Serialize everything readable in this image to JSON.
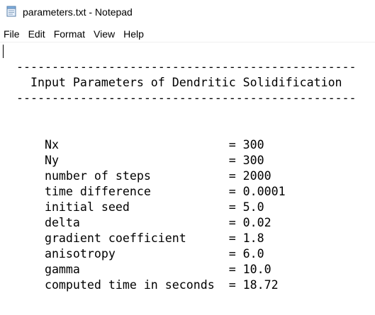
{
  "window": {
    "title": "parameters.txt - Notepad",
    "icon": "notepad-icon"
  },
  "menu": {
    "file": "File",
    "edit": "Edit",
    "format": "Format",
    "view": "View",
    "help": "Help"
  },
  "document": {
    "lines": [
      " ------------------------------------------------",
      "   Input Parameters of Dendritic Solidification",
      " ------------------------------------------------",
      "",
      "",
      "     Nx                        = 300",
      "     Ny                        = 300",
      "     number of steps           = 2000",
      "     time difference           = 0.0001",
      "     initial seed              = 5.0",
      "     delta                     = 0.02",
      "     gradient coefficient      = 1.8",
      "     anisotropy                = 6.0",
      "     gamma                     = 10.0",
      "     computed time in seconds  = 18.72",
      "",
      " ------------------------------------------------"
    ]
  }
}
